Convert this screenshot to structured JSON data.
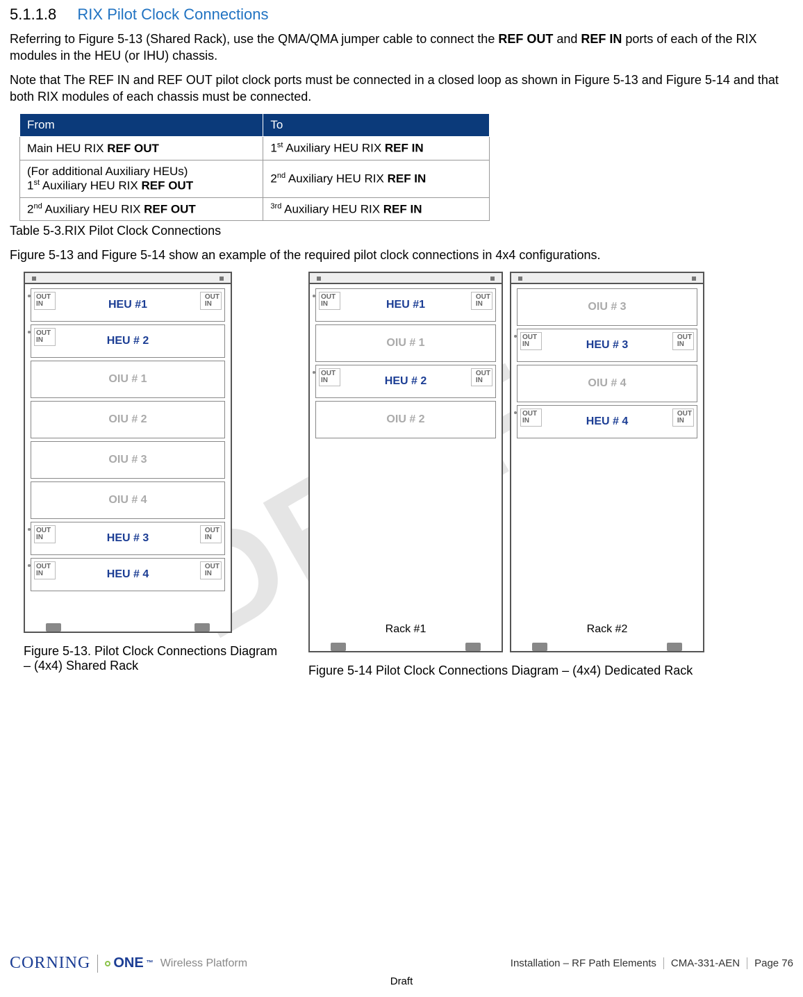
{
  "section": {
    "number": "5.1.1.8",
    "title": "RIX Pilot Clock Connections"
  },
  "paragraphs": {
    "p1_a": "Referring to Figure 5-13 (Shared Rack), use the QMA/QMA jumper cable to connect the ",
    "p1_refout": "REF OUT",
    "p1_b": " and ",
    "p1_refin": "REF IN",
    "p1_c": " ports of each of the RIX modules in the HEU (or IHU) chassis.",
    "p2": "Note that The REF IN and REF OUT pilot clock ports must be connected in a closed loop as shown in Figure 5-13 and Figure 5-14 and that both RIX modules of each chassis must be connected.",
    "p3": "Figure 5-13 and Figure 5-14 show an example of the required pilot clock connections in 4x4 configurations."
  },
  "table": {
    "headers": {
      "from": "From",
      "to": "To"
    },
    "rows": [
      {
        "from_pre": "Main HEU RIX ",
        "from_bold": "REF OUT",
        "to_sup": "st",
        "to_prenum": "1",
        "to_mid": " Auxiliary HEU RIX ",
        "to_bold": "REF IN"
      },
      {
        "from_line1": "(For additional Auxiliary HEUs)",
        "from_prenum": "1",
        "from_sup": "st",
        "from_mid": " Auxiliary HEU RIX ",
        "from_bold": "REF OUT",
        "to_prenum": "2",
        "to_sup": "nd",
        "to_mid": " Auxiliary HEU RIX ",
        "to_bold": "REF IN"
      },
      {
        "from_prenum": "2",
        "from_sup": "nd",
        "from_mid": " Auxiliary HEU RIX ",
        "from_bold": "REF OUT",
        "to_prenum": "",
        "to_sup": "3rd",
        "to_mid": " Auxiliary HEU RIX ",
        "to_bold": "REF IN"
      }
    ],
    "caption": "Table 5-3.RIX Pilot Clock Connections"
  },
  "port_labels": {
    "out": "OUT",
    "in": "IN"
  },
  "racks": {
    "sharedSlots": [
      {
        "type": "heu",
        "label": "HEU #1",
        "ports": "both"
      },
      {
        "type": "heu",
        "label": "HEU # 2",
        "ports": "left"
      },
      {
        "type": "empty",
        "label": "OIU # 1"
      },
      {
        "type": "empty",
        "label": "OIU # 2"
      },
      {
        "type": "empty",
        "label": "OIU # 3"
      },
      {
        "type": "empty",
        "label": "OIU # 4"
      },
      {
        "type": "heu",
        "label": "HEU # 3",
        "ports": "both"
      },
      {
        "type": "heu",
        "label": "HEU # 4",
        "ports": "both"
      }
    ],
    "dedi1Slots": [
      {
        "type": "heu",
        "label": "HEU #1",
        "ports": "both"
      },
      {
        "type": "empty",
        "label": "OIU # 1"
      },
      {
        "type": "heu",
        "label": "HEU # 2",
        "ports": "both"
      },
      {
        "type": "empty",
        "label": "OIU # 2"
      }
    ],
    "dedi2Slots": [
      {
        "type": "empty",
        "label": "OIU # 3"
      },
      {
        "type": "heu",
        "label": "HEU # 3",
        "ports": "both"
      },
      {
        "type": "empty",
        "label": "OIU # 4"
      },
      {
        "type": "heu",
        "label": "HEU # 4",
        "ports": "both"
      }
    ],
    "rack1Label": "Rack #1",
    "rack2Label": "Rack #2"
  },
  "figcaps": {
    "f13": "Figure 5-13. Pilot Clock Connections Diagram – (4x4) Shared Rack",
    "f14": "Figure 5-14 Pilot Clock Connections Diagram – (4x4) Dedicated Rack"
  },
  "watermark": "DRAFT",
  "footer": {
    "brand_corning": "CORNING",
    "brand_one": "ONE",
    "brand_tm": "™",
    "brand_wp": "Wireless Platform",
    "right1": "Installation – RF Path Elements",
    "right2": "CMA-331-AEN",
    "right3": "Page 76",
    "draft": "Draft"
  }
}
